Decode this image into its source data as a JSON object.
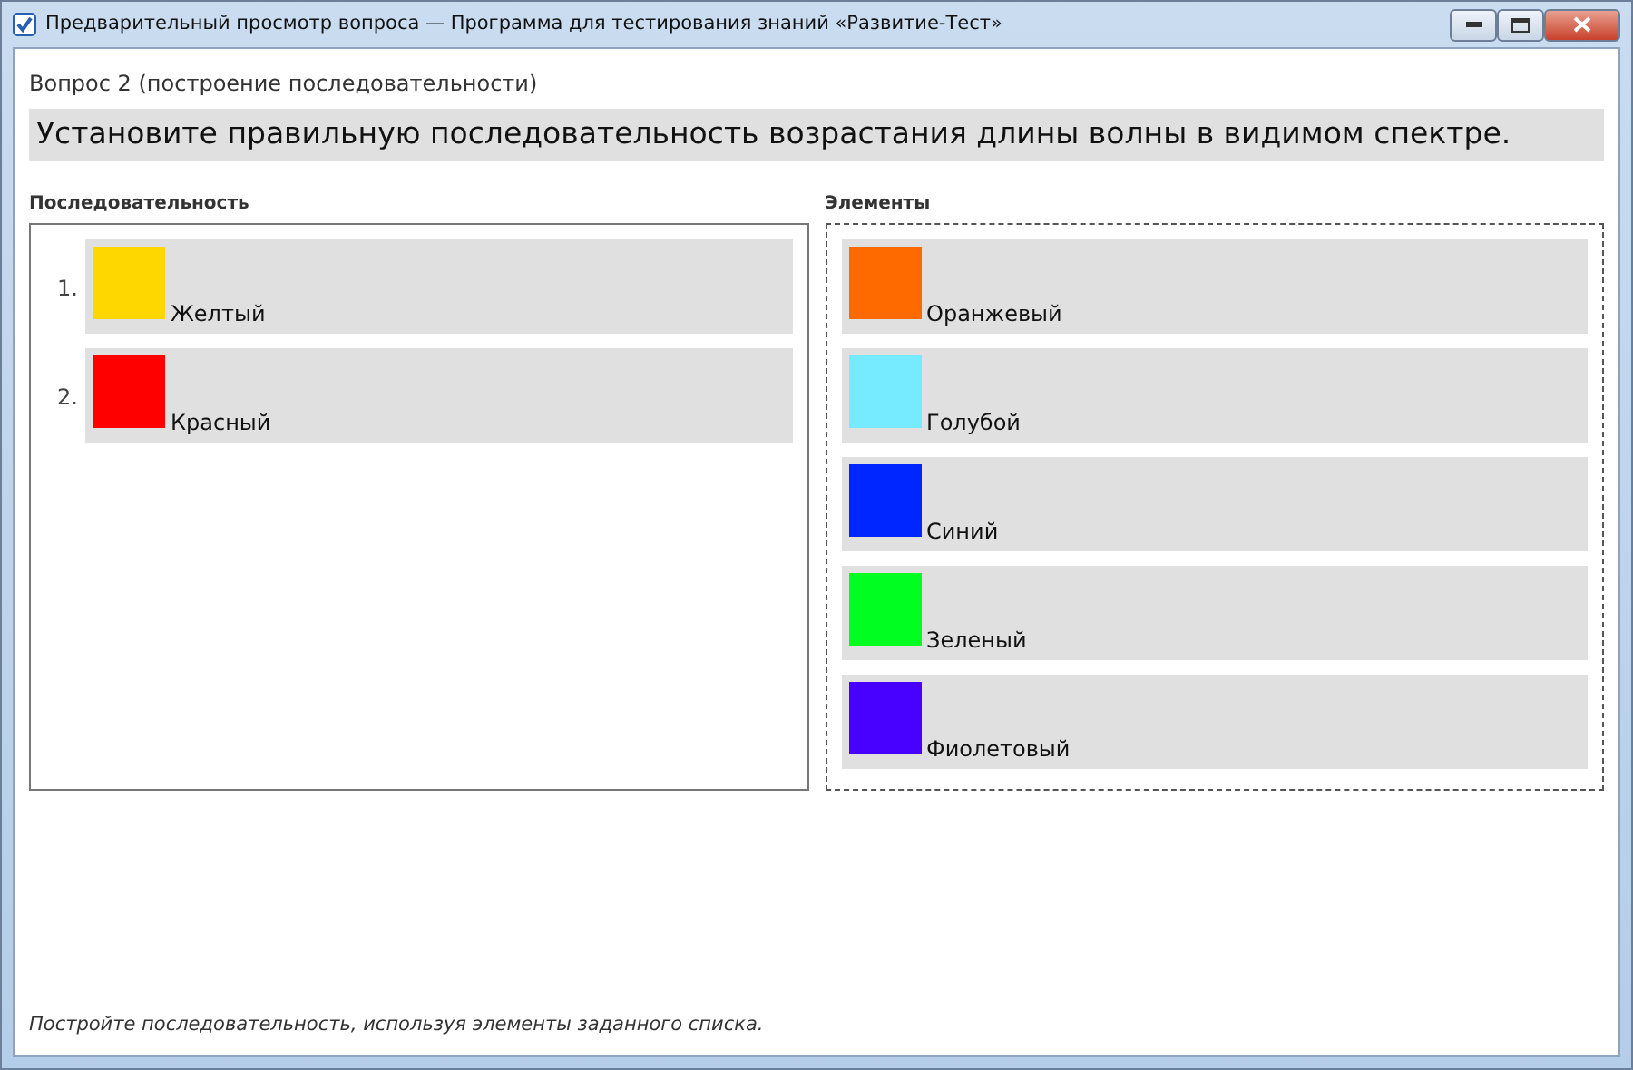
{
  "window": {
    "title": "Предварительный просмотр вопроса — Программа для тестирования знаний «Развитие-Тест»"
  },
  "question": {
    "heading": "Вопрос 2 (построение последовательности)",
    "text": "Установите правильную последовательность возрастания длины волны в видимом спектре."
  },
  "sequence": {
    "label": "Последовательность",
    "items": [
      {
        "number": "1.",
        "name": "Желтый",
        "color": "#ffd700"
      },
      {
        "number": "2.",
        "name": "Красный",
        "color": "#ff0000"
      }
    ]
  },
  "elements": {
    "label": "Элементы",
    "items": [
      {
        "name": "Оранжевый",
        "color": "#ff6a00"
      },
      {
        "name": "Голубой",
        "color": "#76ebff"
      },
      {
        "name": "Синий",
        "color": "#0026ff"
      },
      {
        "name": "Зеленый",
        "color": "#00ff21"
      },
      {
        "name": "Фиолетовый",
        "color": "#4800ff"
      }
    ]
  },
  "hint": "Постройте последовательность, используя элементы заданного списка."
}
